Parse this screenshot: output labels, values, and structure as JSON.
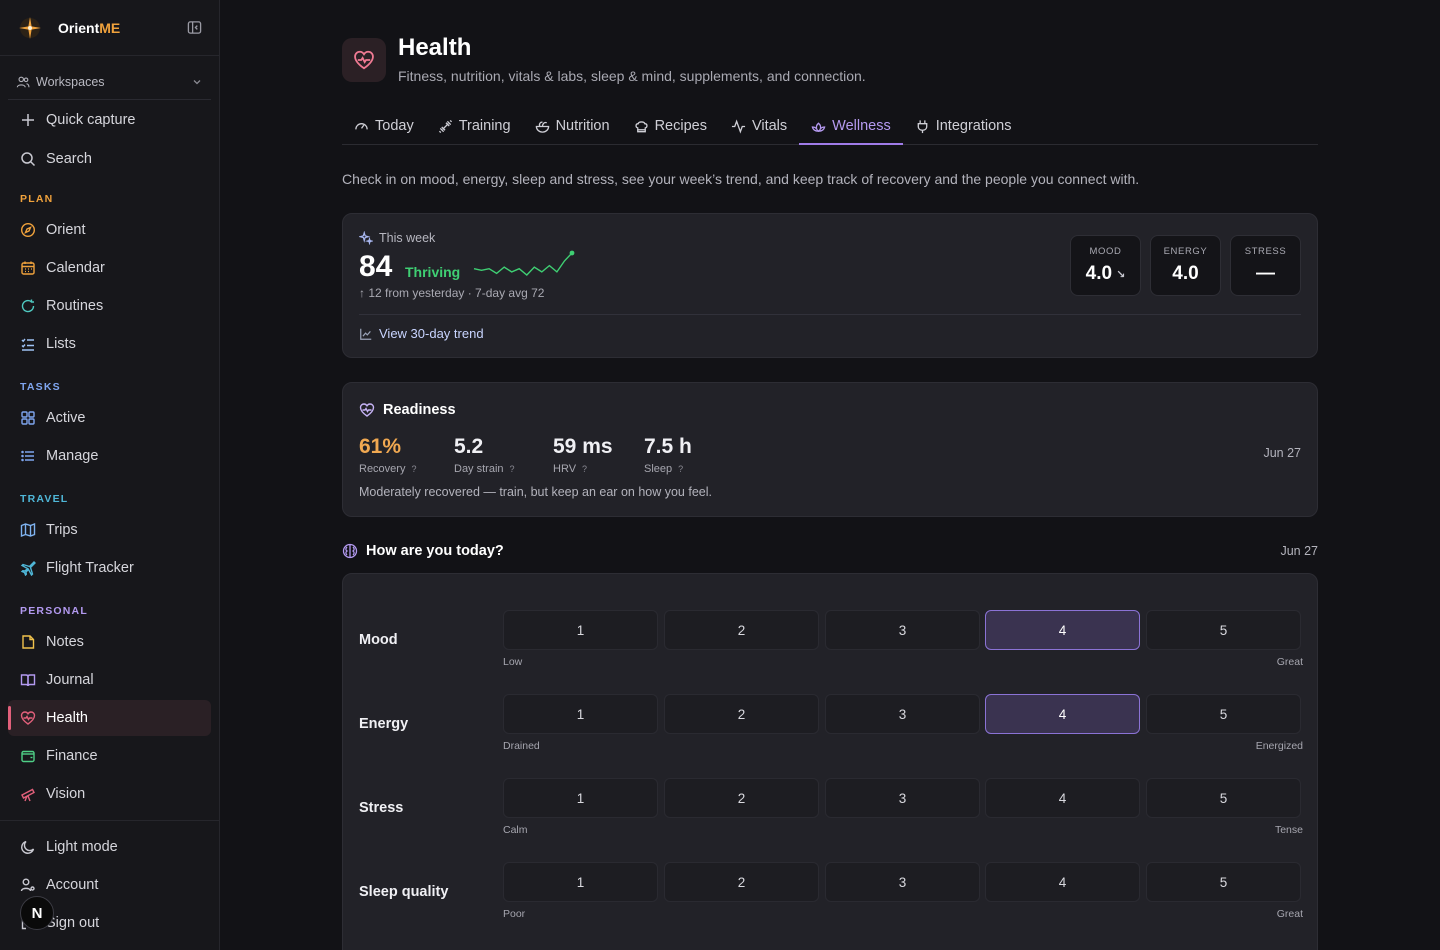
{
  "brand": {
    "name_prefix": "Orient",
    "name_suffix": "ME"
  },
  "workspaces": {
    "label": "Workspaces"
  },
  "nav_top": [
    {
      "label": "Quick capture",
      "icon": "plus-icon"
    },
    {
      "label": "Search",
      "icon": "search-icon"
    }
  ],
  "sections": {
    "plan": {
      "label": "PLAN",
      "color": "#f0a23c"
    },
    "tasks": {
      "label": "TASKS",
      "color": "#7fa6f0"
    },
    "travel": {
      "label": "TRAVEL",
      "color": "#4fb7d8"
    },
    "personal": {
      "label": "PERSONAL",
      "color": "#b39af0"
    }
  },
  "nav": {
    "orient": "Orient",
    "calendar": "Calendar",
    "routines": "Routines",
    "lists": "Lists",
    "active": "Active",
    "manage": "Manage",
    "trips": "Trips",
    "flight_tracker": "Flight Tracker",
    "notes": "Notes",
    "journal": "Journal",
    "health": "Health",
    "finance": "Finance",
    "vision": "Vision",
    "light_mode": "Light mode",
    "account": "Account",
    "sign_out": "Sign out"
  },
  "avatar": {
    "initial": "N"
  },
  "page": {
    "title": "Health",
    "subtitle": "Fitness, nutrition, vitals & labs, sleep & mind, supplements, and connection.",
    "intro": "Check in on mood, energy, sleep and stress, see your week’s trend, and keep track of recovery and the people you connect with."
  },
  "tabs": [
    {
      "label": "Today",
      "icon": "gauge-icon"
    },
    {
      "label": "Training",
      "icon": "dumbbell-icon"
    },
    {
      "label": "Nutrition",
      "icon": "salad-icon"
    },
    {
      "label": "Recipes",
      "icon": "chef-hat-icon"
    },
    {
      "label": "Vitals",
      "icon": "activity-icon"
    },
    {
      "label": "Wellness",
      "icon": "lotus-icon",
      "active": true
    },
    {
      "label": "Integrations",
      "icon": "plug-icon"
    }
  ],
  "week": {
    "heading": "This week",
    "score": "84",
    "status": "Thriving",
    "meta": "12 from yesterday · 7-day avg 72",
    "trend_link": "View 30-day trend",
    "sparkline_values": [
      74,
      73,
      74,
      71,
      75,
      72,
      74,
      70,
      75,
      72,
      76,
      72,
      79,
      84
    ],
    "stats": [
      {
        "label": "MOOD",
        "value": "4.0",
        "trend": "↘"
      },
      {
        "label": "ENERGY",
        "value": "4.0",
        "trend": ""
      },
      {
        "label": "STRESS",
        "value": "—",
        "trend": ""
      }
    ]
  },
  "readiness": {
    "heading": "Readiness",
    "date": "Jun 27",
    "note": "Moderately recovered — train, but keep an ear on how you feel.",
    "metrics": [
      {
        "value": "61%",
        "label": "Recovery",
        "color": "#f0a851"
      },
      {
        "value": "5.2",
        "label": "Day strain",
        "color": "#f0f0f4"
      },
      {
        "value": "59 ms",
        "label": "HRV",
        "color": "#f0f0f4"
      },
      {
        "value": "7.5 h",
        "label": "Sleep",
        "color": "#f0f0f4"
      }
    ],
    "help_glyph": "?"
  },
  "checkin": {
    "heading": "How are you today?",
    "date": "Jun 27",
    "rows": [
      {
        "label": "Mood",
        "low": "Low",
        "high": "Great",
        "options": [
          "1",
          "2",
          "3",
          "4",
          "5"
        ],
        "selected": 4
      },
      {
        "label": "Energy",
        "low": "Drained",
        "high": "Energized",
        "options": [
          "1",
          "2",
          "3",
          "4",
          "5"
        ],
        "selected": 4
      },
      {
        "label": "Stress",
        "low": "Calm",
        "high": "Tense",
        "options": [
          "1",
          "2",
          "3",
          "4",
          "5"
        ],
        "selected": null
      },
      {
        "label": "Sleep quality",
        "low": "Poor",
        "high": "Great",
        "options": [
          "1",
          "2",
          "3",
          "4",
          "5"
        ],
        "selected": null
      }
    ]
  },
  "colors": {
    "accent_purple": "#9f7be8",
    "health_pink": "#e2607b",
    "thriving_green": "#3fcf73",
    "recovery_orange": "#f0a851"
  }
}
